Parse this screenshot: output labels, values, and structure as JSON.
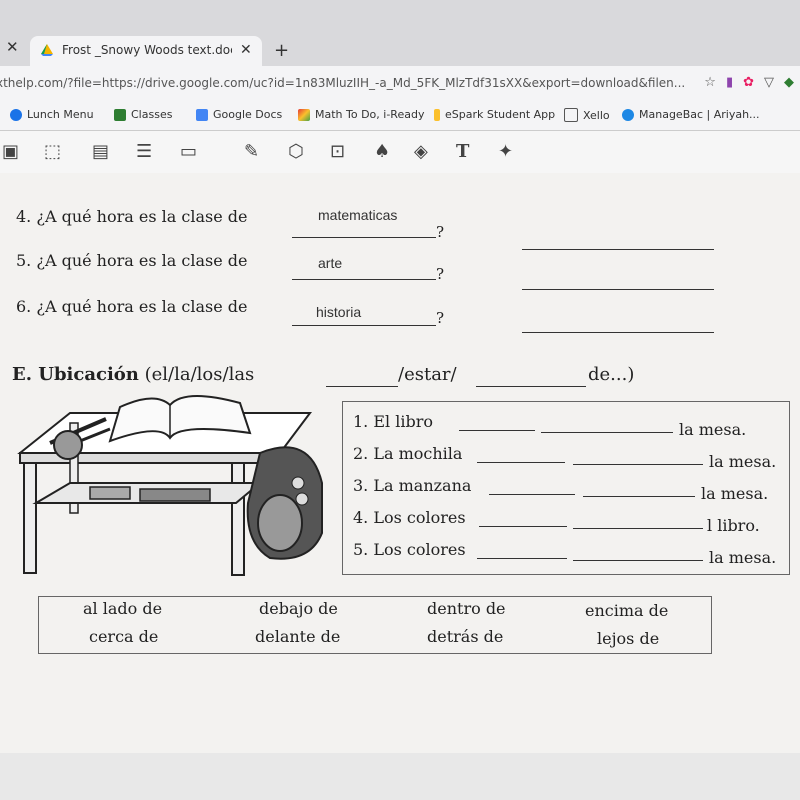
{
  "browser": {
    "tab_title": "Frost _Snowy Woods text.docx",
    "url_prefix": "xthelp.com/?file=https://drive.google.com/uc?id=1n83MluzIIH_-a_Md_5FK_MlzTdf31sXX&export=download&filen...",
    "bookmarks": [
      {
        "label": "Lunch Menu",
        "color": "#1a73e8"
      },
      {
        "label": "Classes",
        "color": "#2e7d32"
      },
      {
        "label": "Google Docs",
        "color": "#4285f4"
      },
      {
        "label": "Math To Do, i-Ready",
        "color": "#e53935"
      },
      {
        "label": "eSpark Student App",
        "color": "#fbc02d"
      },
      {
        "label": "Xello",
        "color": "#555555"
      },
      {
        "label": "ManageBac | Ariyah...",
        "color": "#1e88e5"
      }
    ]
  },
  "questions": [
    {
      "number": "4.",
      "text": "¿A qué hora es la clase de",
      "answer": "matematicas"
    },
    {
      "number": "5.",
      "text": "¿A qué hora es la clase de",
      "answer": "arte"
    },
    {
      "number": "6.",
      "text": "¿A qué hora es la clase de",
      "answer": "historia"
    }
  ],
  "qmark": "?",
  "section_e": {
    "label": "E. Ubicación",
    "rest": "(el/la/los/las",
    "estar": "/estar/",
    "de": "de...)"
  },
  "sentences": [
    {
      "start": "1. El libro",
      "end": "la mesa."
    },
    {
      "start": "2. La mochila",
      "end": "la mesa."
    },
    {
      "start": "3. La manzana",
      "end": "la mesa."
    },
    {
      "start": "4. Los colores",
      "end": "l libro."
    },
    {
      "start": "5. Los colores",
      "end": "la mesa."
    }
  ],
  "word_bank": [
    [
      "al lado de",
      "cerca de"
    ],
    [
      "debajo de",
      "delante de"
    ],
    [
      "dentro de",
      "detrás de"
    ],
    [
      "encima de",
      "lejos de"
    ]
  ]
}
